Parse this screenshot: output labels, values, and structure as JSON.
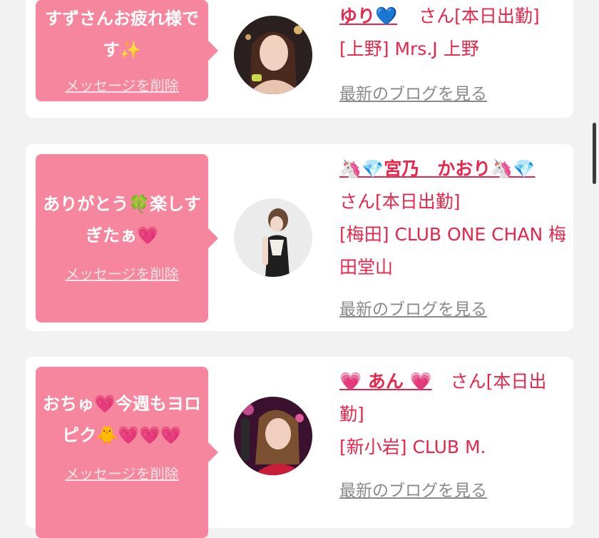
{
  "cards": [
    {
      "message": "すずさんお疲れ様です✨",
      "delete_label": "メッセージを削除",
      "name": "ゆり💙",
      "status": "さん[本日出勤]",
      "shop": "[上野] Mrs.J 上野",
      "blog_label": "最新のブログを見る"
    },
    {
      "message": "ありがとう🍀楽しすぎたぁ💗",
      "delete_label": "メッセージを削除",
      "name": "🦄💎宮乃　かおり🦄💎",
      "status": "さん[本日出勤]",
      "shop": "[梅田] CLUB ONE CHAN 梅田堂山",
      "blog_label": "最新のブログを見る"
    },
    {
      "message": "おちゅ💗今週もヨロピク🐥💗💗💗",
      "delete_label": "メッセージを削除",
      "name": "💗 あん 💗",
      "status": "さん[本日出勤]",
      "shop": "[新小岩] CLUB M.",
      "blog_label": "最新のブログを見る"
    }
  ]
}
